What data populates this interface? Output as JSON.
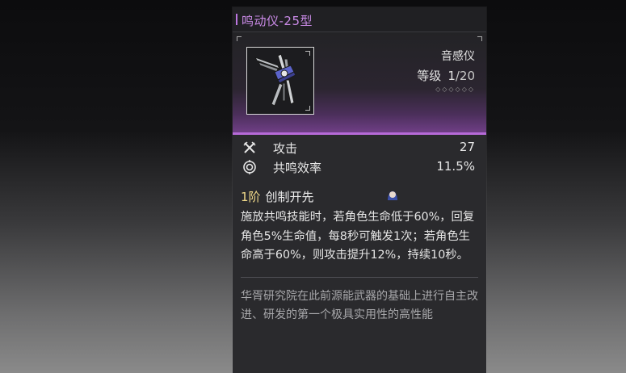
{
  "item": {
    "title": "鸣动仪-25型",
    "type": "音感仪",
    "level_label": "等级",
    "level_value": "1",
    "level_max": "/20",
    "rank_diamonds": "◇◇◇◇◇◇"
  },
  "stats": [
    {
      "icon": "attack-icon",
      "label": "攻击",
      "value": "27"
    },
    {
      "icon": "resonance-efficiency-icon",
      "label": "共鸣效率",
      "value": "11.5%"
    }
  ],
  "skill": {
    "tier": "1阶",
    "name": "创制开先",
    "description": "施放共鸣技能时，若角色生命低于60%，回复角色5%生命值，每8秒可触发1次；若角色生命高于60%，则攻击提升12%，持续10秒。"
  },
  "lore": "华胥研究院在此前源能武器的基础上进行自主改进、研发的第一个极具实用性的高性能",
  "colors": {
    "title": "#c98ae6",
    "accent_purple": "#b66ad8",
    "tier_gold": "#f0d98a"
  }
}
